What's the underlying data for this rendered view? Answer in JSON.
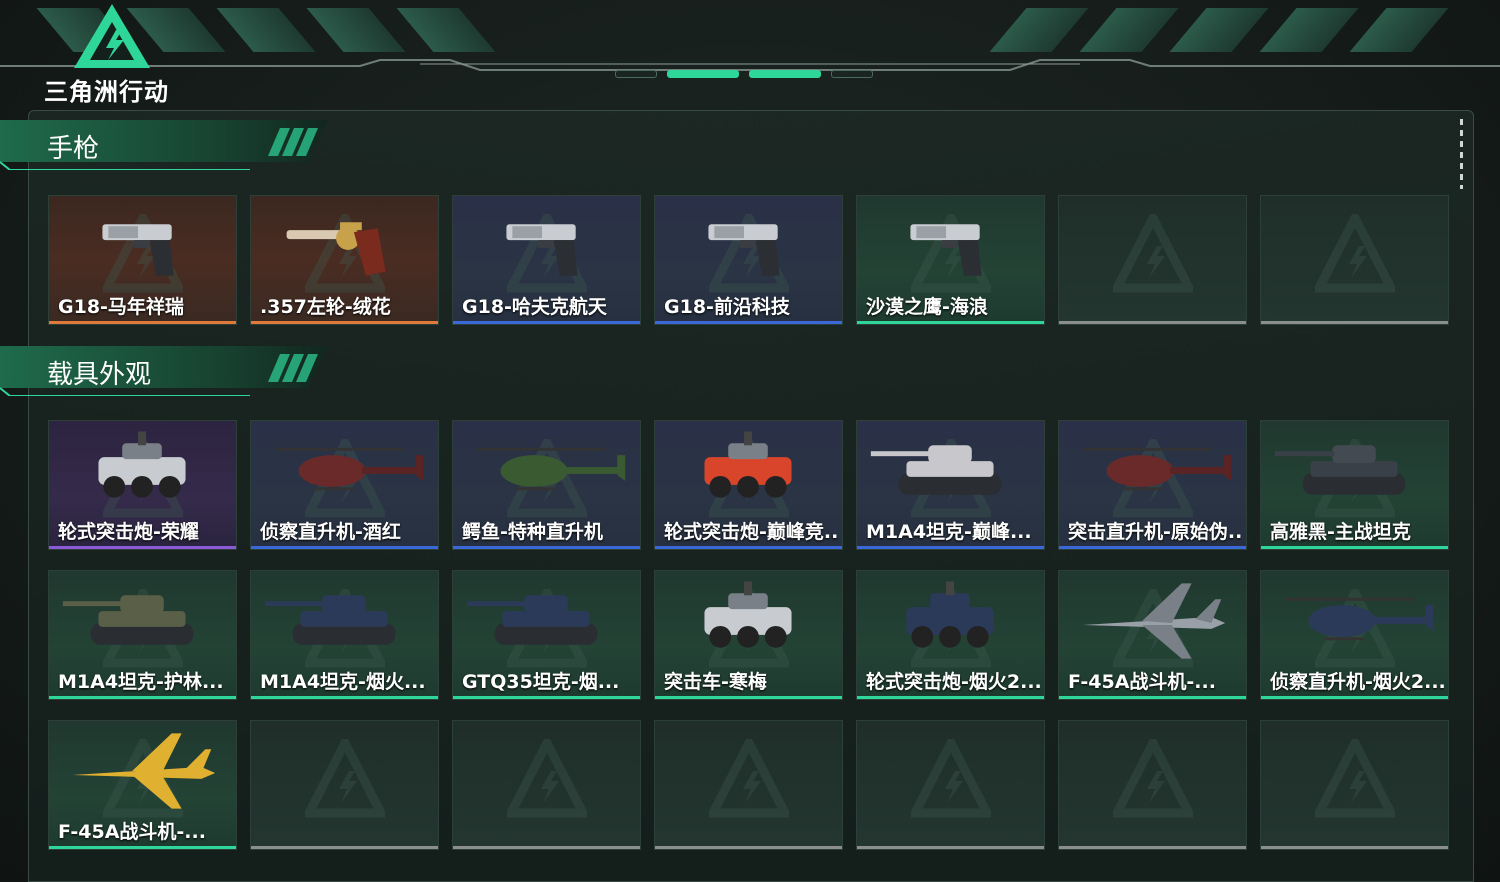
{
  "app": {
    "logo_text": "三角洲行动"
  },
  "colors": {
    "accent": "#2fd69a",
    "rarity_orange": "#e07a3a",
    "rarity_blue": "#3a68d8",
    "rarity_green": "#2fd69a",
    "rarity_purple": "#8a5ad8"
  },
  "sections": {
    "pistols": {
      "title": "手枪",
      "items": [
        {
          "label": "G18-马年祥瑞",
          "rarity": "orange",
          "icon": "pistol"
        },
        {
          "label": ".357左轮-绒花",
          "rarity": "orange",
          "icon": "revolver"
        },
        {
          "label": "G18-哈夫克航天",
          "rarity": "blue",
          "icon": "pistol"
        },
        {
          "label": "G18-前沿科技",
          "rarity": "blue",
          "icon": "pistol"
        },
        {
          "label": "沙漠之鹰-海浪",
          "rarity": "green",
          "icon": "pistol"
        }
      ]
    },
    "vehicles": {
      "title": "载具外观",
      "items": [
        {
          "label": "轮式突击炮-荣耀",
          "rarity": "purple",
          "icon": "armored-car"
        },
        {
          "label": "侦察直升机-酒红",
          "rarity": "blue",
          "icon": "helicopter"
        },
        {
          "label": "鳄鱼-特种直升机",
          "rarity": "blue",
          "icon": "helicopter"
        },
        {
          "label": "轮式突击炮-巅峰竞...",
          "rarity": "blue",
          "icon": "armored-car"
        },
        {
          "label": "M1A4坦克-巅峰...",
          "rarity": "blue",
          "icon": "tank"
        },
        {
          "label": "突击直升机-原始伪...",
          "rarity": "blue",
          "icon": "helicopter"
        },
        {
          "label": "高雅黑-主战坦克",
          "rarity": "green",
          "icon": "tank"
        },
        {
          "label": "M1A4坦克-护林...",
          "rarity": "green",
          "icon": "tank"
        },
        {
          "label": "M1A4坦克-烟火...",
          "rarity": "green",
          "icon": "tank"
        },
        {
          "label": "GTQ35坦克-烟...",
          "rarity": "green",
          "icon": "tank"
        },
        {
          "label": "突击车-寒梅",
          "rarity": "green",
          "icon": "armored-car"
        },
        {
          "label": "轮式突击炮-烟火2...",
          "rarity": "green",
          "icon": "armored-car"
        },
        {
          "label": "F-45A战斗机-...",
          "rarity": "green",
          "icon": "jet"
        },
        {
          "label": "侦察直升机-烟火2...",
          "rarity": "green",
          "icon": "helicopter"
        },
        {
          "label": "F-45A战斗机-...",
          "rarity": "green",
          "icon": "jet"
        }
      ]
    }
  }
}
